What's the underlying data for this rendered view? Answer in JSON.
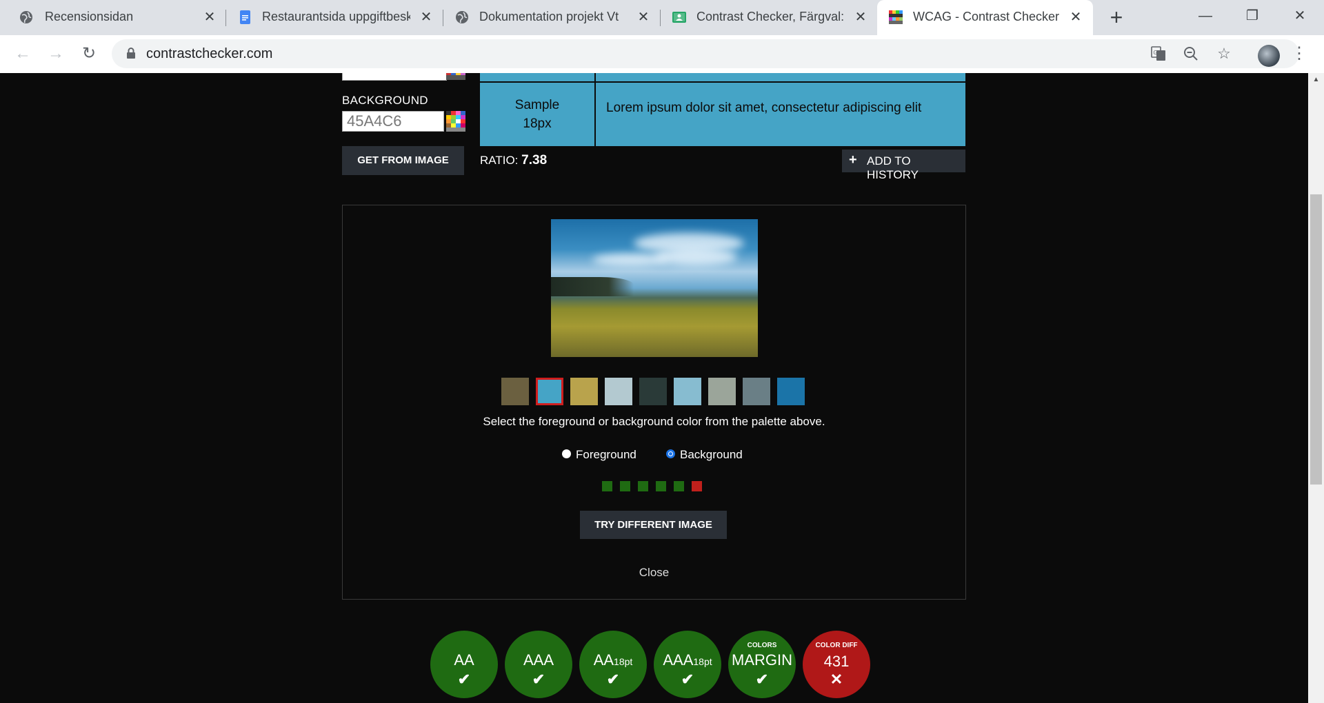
{
  "browser": {
    "tabs": [
      {
        "title": "Recensionsidan",
        "icon": "globe-icon"
      },
      {
        "title": "Restaurantsida uppgiftbeskrivning",
        "icon": "google-docs-icon"
      },
      {
        "title": "Dokumentation projekt Vt",
        "icon": "globe-icon"
      },
      {
        "title": "Contrast Checker, Färgval: Illustrationer",
        "icon": "google-classroom-icon"
      },
      {
        "title": "WCAG - Contrast Checker",
        "icon": "contrast-checker-favicon"
      }
    ],
    "new_tab_symbol": "+",
    "close_symbol": "✕",
    "window_controls": {
      "minimize": "—",
      "restore": "❐",
      "close": "✕"
    },
    "url": "contrastchecker.com"
  },
  "checker": {
    "background_label": "BACKGROUND",
    "background_value": "45A4C6",
    "get_from_image_label": "GET FROM IMAGE",
    "sample_label_line1": "Sample",
    "sample_label_line2": "18px",
    "sample_text": "Lorem ipsum dolor sit amet, consectetur adipiscing elit",
    "sample_color": "#45A4C6",
    "ratio_label": "RATIO:",
    "ratio_value": "7.38",
    "add_history_label": "ADD TO HISTORY"
  },
  "image_picker": {
    "palette": [
      "#6b6040",
      "#45a4c6",
      "#b9a34c",
      "#b3c9d0",
      "#2a3a38",
      "#87bcd0",
      "#9ba59a",
      "#6a7f86",
      "#1b74a8"
    ],
    "selected_index": 1,
    "instruction": "Select the foreground or background color from the palette above.",
    "radio_foreground": "Foreground",
    "radio_background": "Background",
    "selected_radio": "Background",
    "result_dots": [
      "#1f6b12",
      "#1f6b12",
      "#1f6b12",
      "#1f6b12",
      "#1f6b12",
      "#c0201c"
    ],
    "try_button": "TRY DIFFERENT IMAGE",
    "close_label": "Close"
  },
  "badges": [
    {
      "label": "AA",
      "suffix": "",
      "status": "pass",
      "mark": "✔",
      "color": "#1f6b12"
    },
    {
      "label": "AAA",
      "suffix": "",
      "status": "pass",
      "mark": "✔",
      "color": "#1f6b12"
    },
    {
      "label": "AA",
      "suffix": "18pt",
      "status": "pass",
      "mark": "✔",
      "color": "#1f6b12"
    },
    {
      "label": "AAA",
      "suffix": "18pt",
      "status": "pass",
      "mark": "✔",
      "color": "#1f6b12"
    },
    {
      "label": "MARGIN",
      "top": "COLORS",
      "status": "pass",
      "mark": "✔",
      "color": "#1f6b12"
    },
    {
      "label": "431",
      "top": "COLOR DIFF",
      "status": "fail",
      "mark": "✕",
      "color": "#b01818"
    }
  ]
}
